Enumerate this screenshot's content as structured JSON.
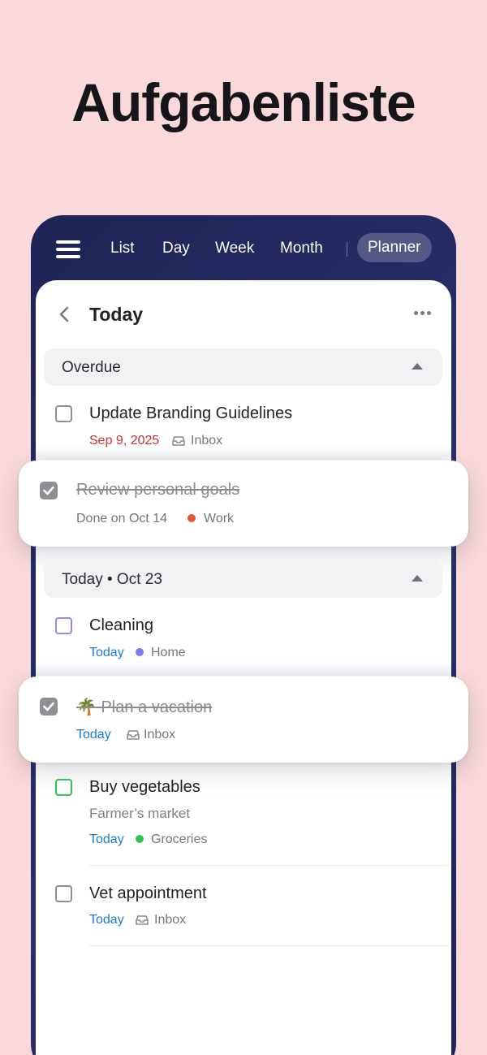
{
  "hero": {
    "title": "Aufgabenliste"
  },
  "nav": {
    "tabs": [
      "List",
      "Day",
      "Week",
      "Month"
    ],
    "active_tab": "Planner",
    "icons": {
      "menu": "hamburger-menu-icon"
    }
  },
  "header": {
    "title": "Today",
    "back_icon": "chevron-left-icon",
    "more_icon": "ellipsis-icon"
  },
  "sections": [
    {
      "label": "Overdue",
      "expanded": true
    },
    {
      "label": "Today • Oct 23",
      "expanded": true
    }
  ],
  "tasks": [
    {
      "title": "Update Branding Guidelines",
      "date": "Sep 9, 2025",
      "list": "Inbox",
      "checked": false
    },
    {
      "title": "Review personal goals",
      "done_text": "Done on Oct 14",
      "list": "Work",
      "list_color": "#e8542b",
      "checked": true
    },
    {
      "title": "Cleaning",
      "date": "Today",
      "list": "Home",
      "list_color": "#7b7cf3",
      "checked": false,
      "box_color": "#8d8ef0"
    },
    {
      "title": "🌴 Plan a vacation",
      "date": "Today",
      "list": "Inbox",
      "checked": true
    },
    {
      "title": "Buy vegetables",
      "note": "Farmer’s market",
      "date": "Today",
      "list": "Groceries",
      "list_color": "#2fc552",
      "checked": false,
      "box_color": "#2fc552"
    },
    {
      "title": "Vet appointment",
      "date": "Today",
      "list": "Inbox",
      "checked": false
    }
  ],
  "colors": {
    "background": "#f9d9d9",
    "accent_blue": "#1a7ad6",
    "overdue_red": "#d0312d",
    "header_navy": "#232862"
  }
}
